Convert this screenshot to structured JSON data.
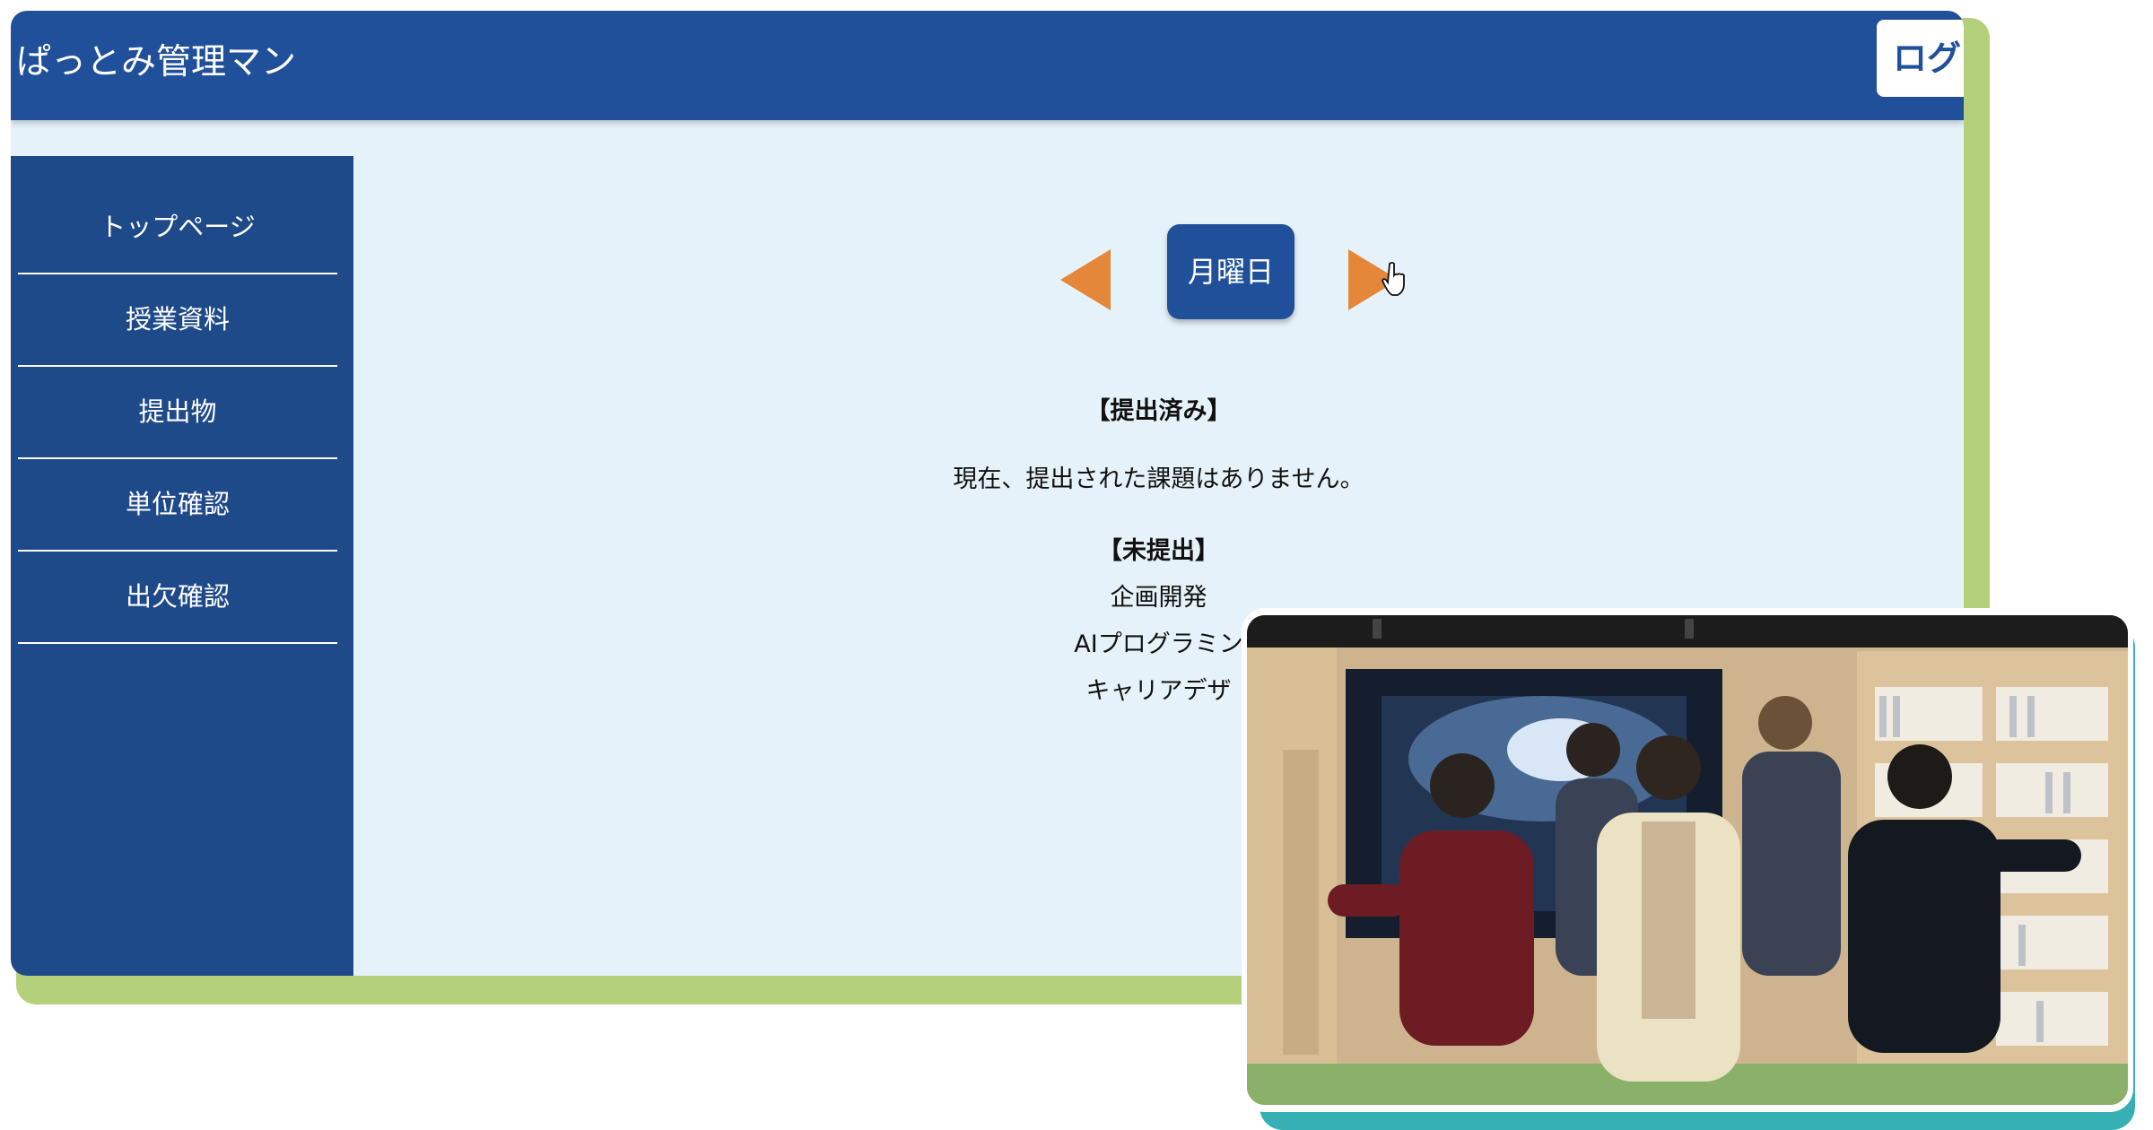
{
  "app": {
    "title": "ぱっとみ管理マン",
    "logout_label": "ログ"
  },
  "sidebar": {
    "items": [
      {
        "label": "トップページ"
      },
      {
        "label": "授業資料"
      },
      {
        "label": "提出物"
      },
      {
        "label": "単位確認"
      },
      {
        "label": "出欠確認"
      }
    ]
  },
  "schedule": {
    "day_label": "月曜日",
    "submitted_heading": "【提出済み】",
    "submitted_empty": "現在、提出された課題はありません。",
    "unsubmitted_heading": "【未提出】",
    "unsubmitted_items": [
      "企画開発",
      "AIプログラミン",
      "キャリアデザ"
    ]
  },
  "colors": {
    "header_blue": "#21509b",
    "sidebar_blue": "#1f4a8a",
    "content_bg": "#e6f2f9",
    "arrow_orange": "#e4873a",
    "card_accent_green": "#b5d07a",
    "photo_accent_teal": "#36b0b4"
  },
  "icons": {
    "prev": "triangle-left-icon",
    "next": "triangle-right-icon",
    "cursor": "hand-pointer-icon"
  }
}
